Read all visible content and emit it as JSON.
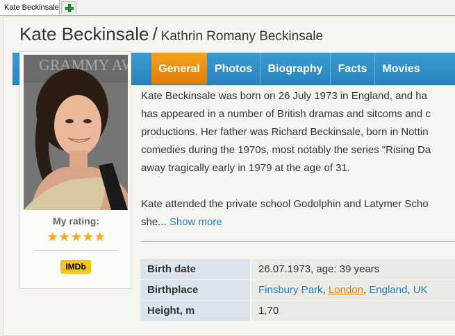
{
  "browser": {
    "tab_title": "Kate Beckinsale"
  },
  "person": {
    "name": "Kate Beckinsale",
    "separator": "/",
    "full_name": "Kathrin Romany Beckinsale"
  },
  "tabs": [
    {
      "label": "General",
      "active": true
    },
    {
      "label": "Photos",
      "active": false
    },
    {
      "label": "Biography",
      "active": false
    },
    {
      "label": "Facts",
      "active": false
    },
    {
      "label": "Movies",
      "active": false
    }
  ],
  "card": {
    "rating_label": "My rating:",
    "stars": "★★★★★",
    "rating": 5,
    "imdb_label": "IMDb"
  },
  "bio": {
    "lines": [
      "Kate Beckinsale was born on 26 July 1973 in England, and ha",
      "has appeared in a number of British dramas and sitcoms and c",
      "productions. Her father was Richard Beckinsale, born in Nottin",
      "comedies during the 1970s, most notably the series \"Rising Da",
      "away tragically early in 1979 at the age of 31."
    ],
    "line6": "Kate attended the private school Godolphin and Latymer Scho",
    "line7": "she...",
    "show_more": "Show more"
  },
  "facts": {
    "birth_date_label": "Birth date",
    "birth_date_value": "26.07.1973, age: 39 years",
    "birthplace_label": "Birthplace",
    "birthplace": [
      "Finsbury Park",
      "London",
      "England",
      "UK"
    ],
    "height_label": "Height, m",
    "height_value": "1,70"
  },
  "colors": {
    "nav_blue": "#2a84bd",
    "active_orange": "#e27b0b",
    "link": "#1e7fb8",
    "star": "#f5a623"
  }
}
